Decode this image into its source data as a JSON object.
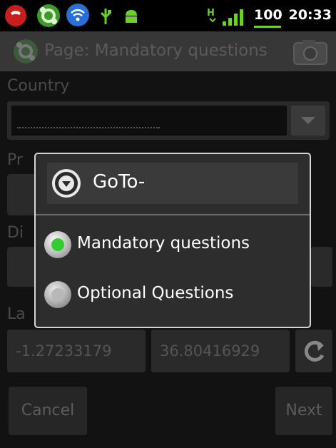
{
  "status_bar": {
    "battery": "100",
    "time": "20:33",
    "icons": [
      "call-icon",
      "sync-icon",
      "wifi-icon",
      "usb-icon",
      "android-icon",
      "signal-icon"
    ]
  },
  "title_bar": {
    "title": "Page: Mandatory questions",
    "icons": [
      "app-logo-icon",
      "camera-icon"
    ]
  },
  "form": {
    "country_label": "Country",
    "country_value": "",
    "province_label": "Pr",
    "district_label": "Di",
    "location_label": "La",
    "latitude": "-1.27233179",
    "longitude": "36.80416929",
    "cancel_label": "Cancel",
    "next_label": "Next"
  },
  "dialog": {
    "title": "GoTo-",
    "options": [
      {
        "label": "Mandatory questions",
        "selected": true
      },
      {
        "label": "Optional Questions",
        "selected": false
      }
    ]
  },
  "colors": {
    "radio_selected": "#33cc33",
    "battery_accent": "#6cd02a"
  }
}
